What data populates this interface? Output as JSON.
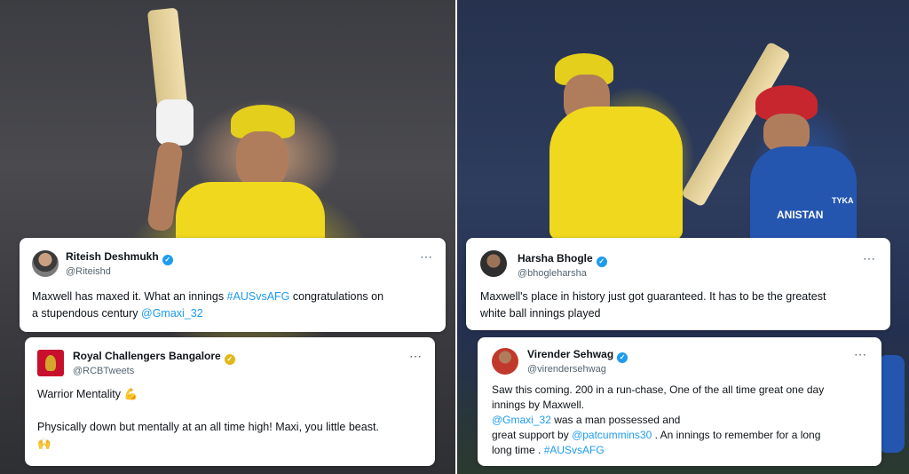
{
  "tweets": [
    {
      "name": "Riteish Deshmukh",
      "handle": "@Riteishd",
      "verified": "blue",
      "line1_a": "Maxwell has maxed it. What an innings ",
      "line1_tag": "#AUSvsAFG",
      "line1_b": "  congratulations on",
      "line2_a": "a stupendous century ",
      "line2_mention": "@Gmaxi_32"
    },
    {
      "name": "Royal Challengers Bangalore",
      "handle": "@RCBTweets",
      "verified": "gold",
      "line1": "Warrior Mentality 💪",
      "line2": "Physically down but mentally at an all time high! Maxi, you little beast.",
      "line3": "🙌"
    },
    {
      "name": "Harsha Bhogle",
      "handle": "@bhogleharsha",
      "verified": "blue",
      "line1": "Maxwell's place in history just got guaranteed. It has to be the greatest",
      "line2": "white ball innings played"
    },
    {
      "name": "Virender Sehwag",
      "handle": "@virendersehwag",
      "verified": "blue",
      "line1": "Saw this coming. 200 in a run-chase, One of the all time great one day",
      "line2": "innings  by Maxwell.",
      "line3_mention": "@Gmaxi_32",
      "line3_b": " was a man possessed and",
      "line4_a": "great support by ",
      "line4_mention": "@patcummins30",
      "line4_b": " . An innings to remember for a long",
      "line5_a": "long time . ",
      "line5_tag": "#AUSvsAFG"
    }
  ],
  "more_icon": "⋯",
  "photo_text": {
    "afg_jersey": "ANISTAN",
    "sponsor": "TYKA"
  }
}
